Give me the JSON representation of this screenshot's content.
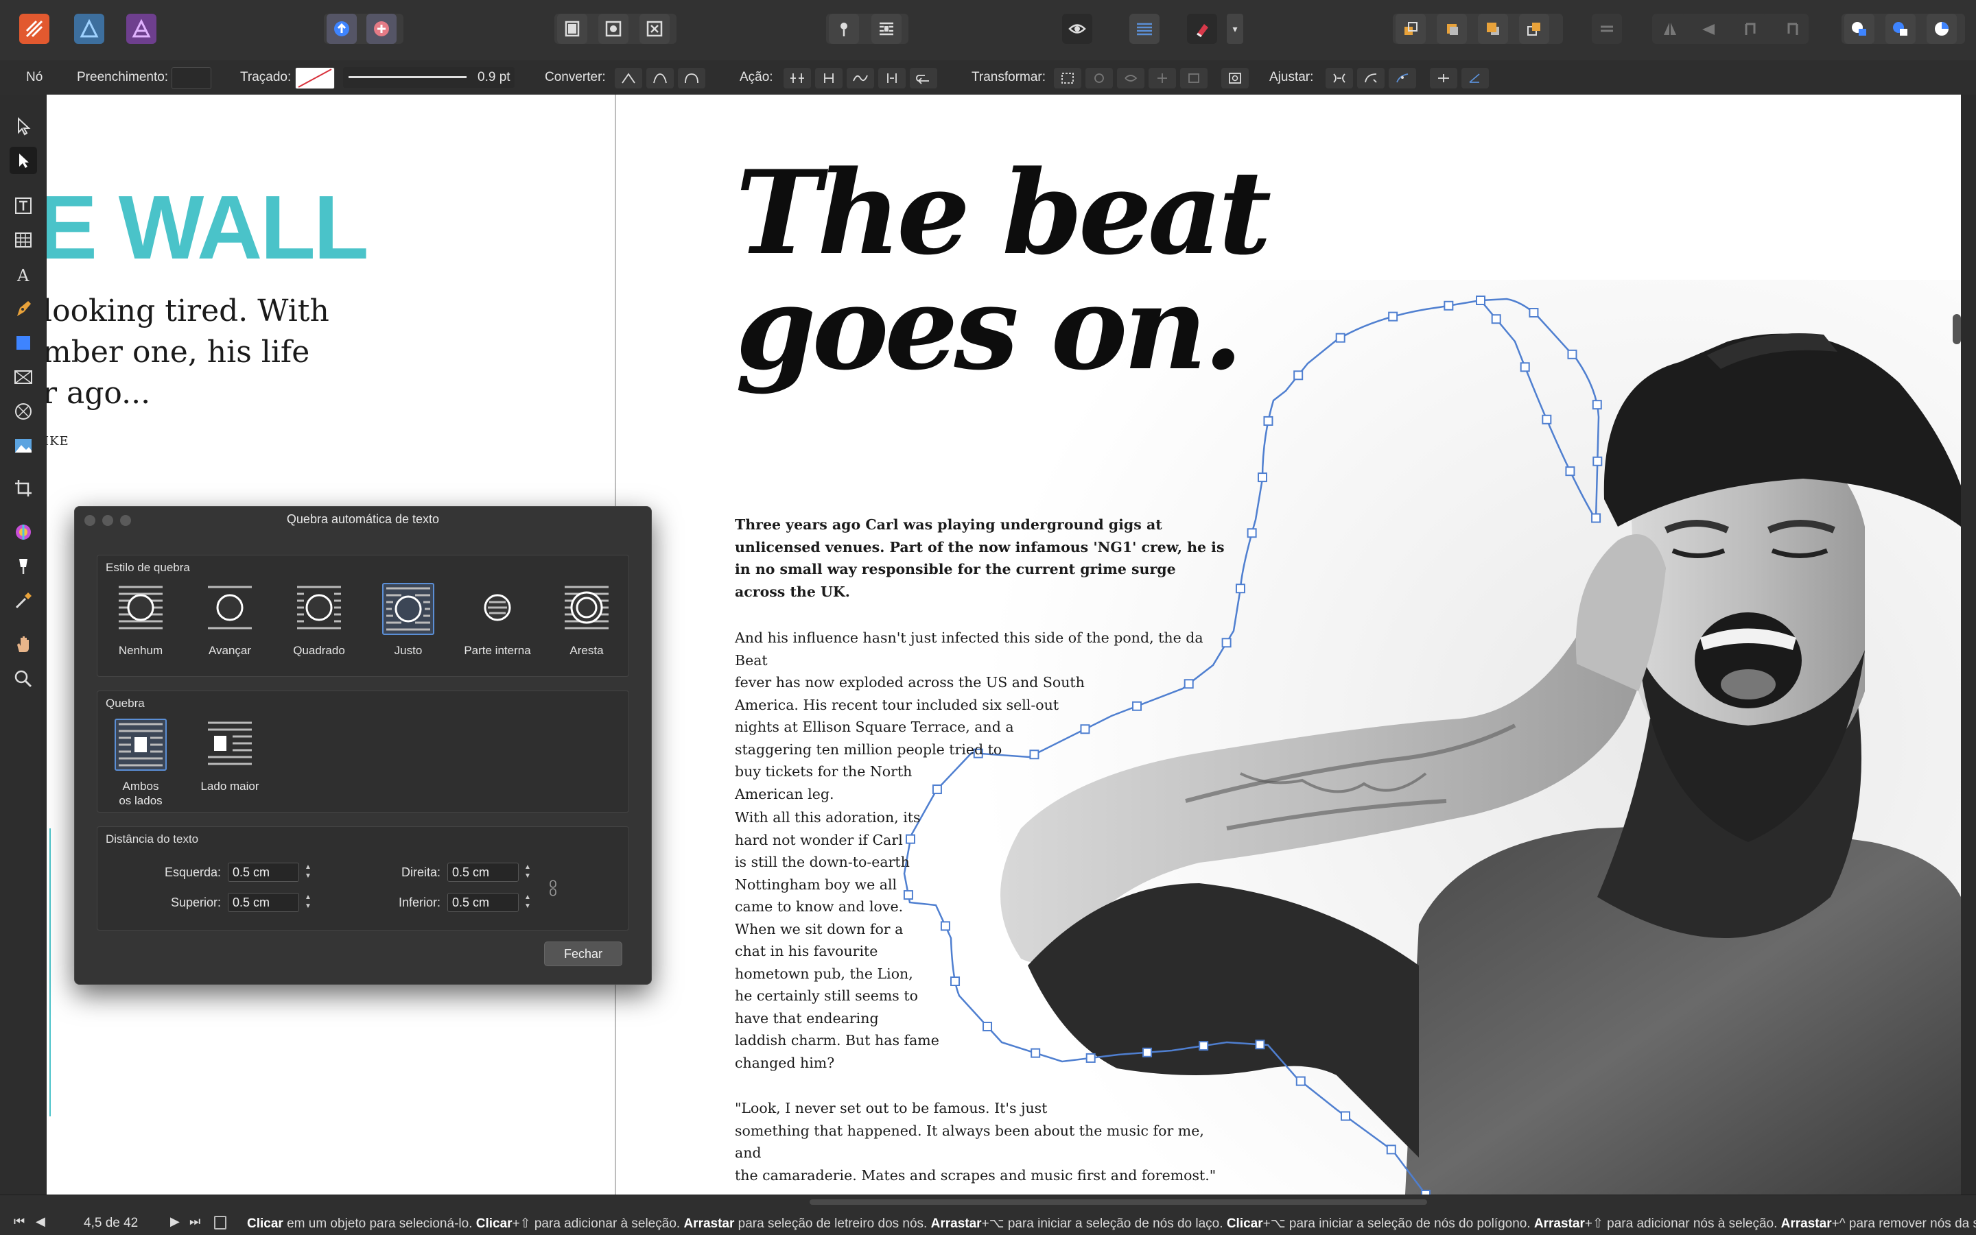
{
  "app": "Affinity Publisher",
  "context_bar": {
    "node_label": "Nó",
    "fill_label": "Preenchimento:",
    "stroke_label": "Traçado:",
    "stroke_width": "0.9 pt",
    "convert_label": "Converter:",
    "action_label": "Ação:",
    "transform_label": "Transformar:",
    "snap_label": "Ajustar:"
  },
  "document": {
    "left_page": {
      "title": "E WALL",
      "deck_lines": [
        "looking tired. With",
        "mber one, his life",
        "r ago..."
      ],
      "byline": "IKE"
    },
    "headline_lines": [
      "The beat",
      "goes on."
    ],
    "lead_paragraph": "Three years ago Carl was playing underground gigs at unlicensed venues. Part of the now infamous 'NG1' crew, he is in no small way responsible for the current grime surge across the UK.",
    "paragraph_1_lines": [
      "And his influence hasn't just infected this side of the pond, the da Beat",
      "fever has now exploded across the US and South",
      "America. His recent tour included six sell-out",
      "nights at Ellison Square Terrace, and a",
      "staggering ten million people tried to",
      "buy tickets for the North",
      "American leg."
    ],
    "paragraph_2_lines": [
      "With all this adoration, its",
      "hard not wonder if Carl",
      "is still the down-to-earth",
      "Nottingham boy we all",
      "came to know and love.",
      "When we sit down for a",
      "chat in his favourite",
      "hometown pub, the Lion,",
      "he certainly still seems to",
      "have that endearing",
      "laddish charm. But has fame",
      "changed him?"
    ],
    "paragraph_3_lines": [
      "\"Look, I never set out to be famous. It's just",
      "something that happened. It always been about the music for me, and",
      "the camaraderie. Mates and scrapes and music first and foremost.\""
    ]
  },
  "dialog": {
    "title": "Quebra automática de texto",
    "wrap_style_title": "Estilo de quebra",
    "wrap_styles": [
      {
        "label": "Nenhum",
        "icon": "wrap-none-icon",
        "selected": false
      },
      {
        "label": "Avançar",
        "icon": "wrap-jump-icon",
        "selected": false
      },
      {
        "label": "Quadrado",
        "icon": "wrap-square-icon",
        "selected": false
      },
      {
        "label": "Justo",
        "icon": "wrap-tight-icon",
        "selected": true
      },
      {
        "label": "Parte interna",
        "icon": "wrap-through-icon",
        "selected": false
      },
      {
        "label": "Aresta",
        "icon": "wrap-edge-icon",
        "selected": false
      }
    ],
    "wrap_side_title": "Quebra",
    "wrap_sides": [
      {
        "label_lines": [
          "Ambos",
          "os lados"
        ],
        "icon": "wrap-both-sides-icon",
        "selected": true
      },
      {
        "label_lines": [
          "Lado maior"
        ],
        "icon": "wrap-largest-side-icon",
        "selected": false
      }
    ],
    "distance_title": "Distância do texto",
    "distance": {
      "left_label": "Esquerda:",
      "left_value": "0.5 cm",
      "right_label": "Direita:",
      "right_value": "0.5 cm",
      "top_label": "Superior:",
      "top_value": "0.5 cm",
      "bottom_label": "Inferior:",
      "bottom_value": "0.5 cm"
    },
    "close_button": "Fechar"
  },
  "status_bar": {
    "page_indicator": "4,5 de 42",
    "hint_parts": [
      {
        "t": "Clicar",
        "b": true
      },
      {
        "t": " em um objeto para selecioná-lo. ",
        "b": false
      },
      {
        "t": "Clicar",
        "b": true
      },
      {
        "t": "+⇧ para adicionar à seleção. ",
        "b": false
      },
      {
        "t": "Arrastar",
        "b": true
      },
      {
        "t": " para seleção de letreiro dos nós. ",
        "b": false
      },
      {
        "t": "Arrastar",
        "b": true
      },
      {
        "t": "+⌥ para iniciar a seleção de nós do laço. ",
        "b": false
      },
      {
        "t": "Clicar",
        "b": true
      },
      {
        "t": "+⌥ para iniciar a seleção de nós do polígono. ",
        "b": false
      },
      {
        "t": "Arrastar",
        "b": true
      },
      {
        "t": "+⇧ para adicionar nós à seleção. ",
        "b": false
      },
      {
        "t": "Arrastar",
        "b": true
      },
      {
        "t": "+^ para remover nós da seleção",
        "b": false
      }
    ]
  },
  "colors": {
    "accent_teal": "#4ac3c9",
    "selection_blue": "#5b8fd6",
    "curve_blue": "#4f7fd0"
  }
}
